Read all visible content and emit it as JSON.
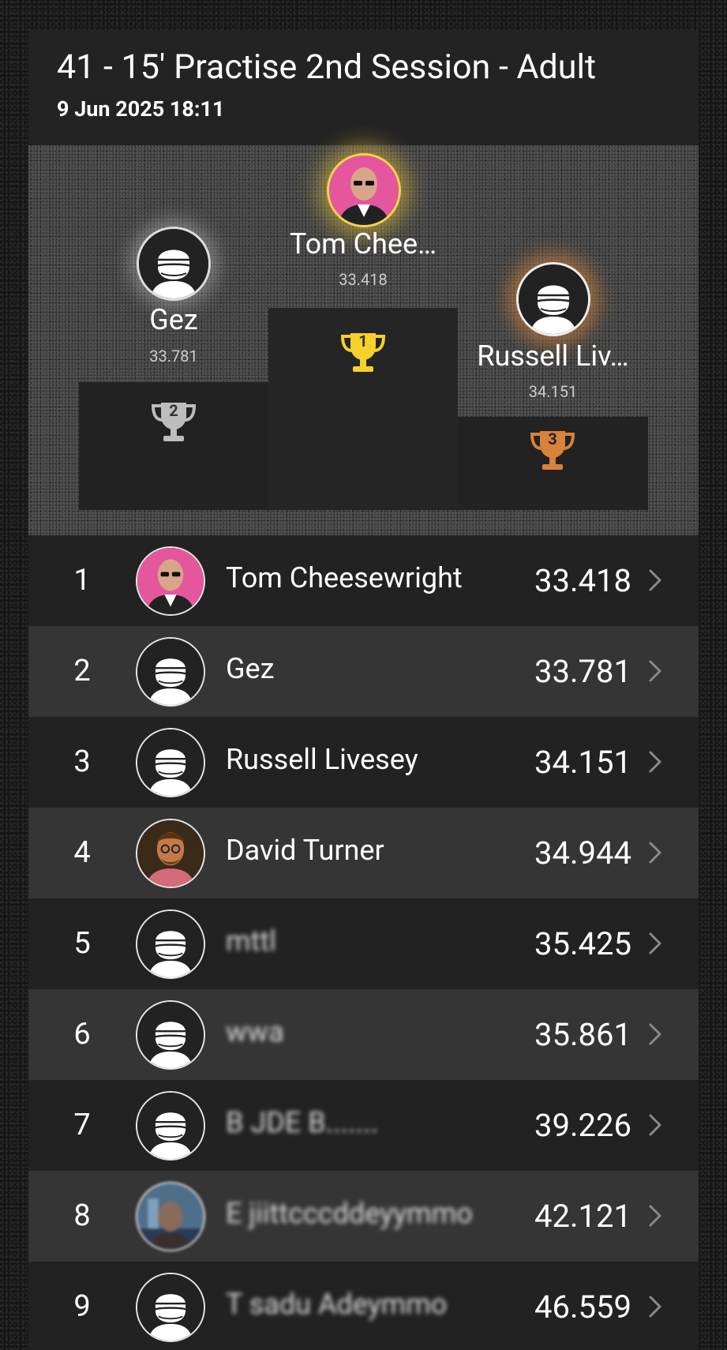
{
  "header": {
    "title": "41 - 15' Practise 2nd Session - Adult",
    "date": "9 Jun 2025 18:11"
  },
  "podium": {
    "first": {
      "place": "1",
      "name": "Tom Chee…",
      "time": "33.418",
      "avatar": "photo-pink"
    },
    "second": {
      "place": "2",
      "name": "Gez",
      "time": "33.781",
      "avatar": "default-helmet-icon"
    },
    "third": {
      "place": "3",
      "name": "Russell Liv…",
      "time": "34.151",
      "avatar": "default-helmet-icon"
    },
    "colors": {
      "gold": "#f6d02b",
      "silver": "#bdbdbd",
      "bronze": "#d9823a"
    }
  },
  "results": [
    {
      "rank": "1",
      "name": "Tom Cheesewright",
      "time": "33.418",
      "avatar": "photo-pink"
    },
    {
      "rank": "2",
      "name": "Gez",
      "time": "33.781",
      "avatar": "default-helmet-icon"
    },
    {
      "rank": "3",
      "name": "Russell Livesey",
      "time": "34.151",
      "avatar": "default-helmet-icon"
    },
    {
      "rank": "4",
      "name": "David Turner",
      "time": "34.944",
      "avatar": "photo-cartoon"
    },
    {
      "rank": "5",
      "name": "mttl",
      "time": "35.425",
      "avatar": "default-helmet-icon"
    },
    {
      "rank": "6",
      "name": "wwa",
      "time": "35.861",
      "avatar": "default-helmet-icon"
    },
    {
      "rank": "7",
      "name": "B            JDE B.......",
      "time": "39.226",
      "avatar": "default-helmet-icon"
    },
    {
      "rank": "8",
      "name": "E          jiittcccddeyymmo",
      "time": "42.121",
      "avatar": "photo-blurred"
    },
    {
      "rank": "9",
      "name": "T       sadu Adeymmo",
      "time": "46.559",
      "avatar": "default-helmet-icon"
    }
  ]
}
